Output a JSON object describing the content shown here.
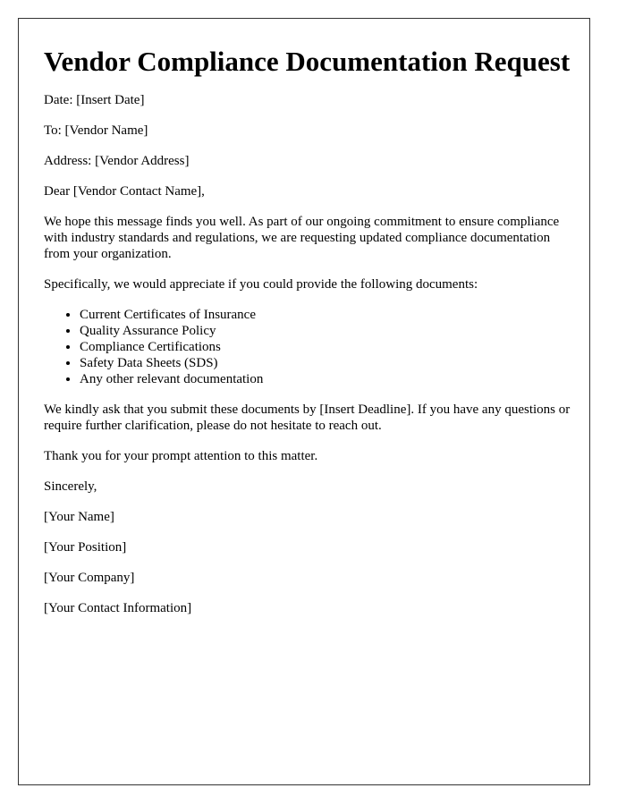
{
  "document": {
    "title": "Vendor Compliance Documentation Request",
    "date_line": "Date: [Insert Date]",
    "to_line": "To: [Vendor Name]",
    "address_line": "Address: [Vendor Address]",
    "salutation": "Dear [Vendor Contact Name],",
    "intro_paragraph": "We hope this message finds you well. As part of our ongoing commitment to ensure compliance with industry standards and regulations, we are requesting updated compliance documentation from your organization.",
    "list_intro": "Specifically, we would appreciate if you could provide the following documents:",
    "documents": [
      "Current Certificates of Insurance",
      "Quality Assurance Policy",
      "Compliance Certifications",
      "Safety Data Sheets (SDS)",
      "Any other relevant documentation"
    ],
    "deadline_paragraph": "We kindly ask that you submit these documents by [Insert Deadline]. If you have any questions or require further clarification, please do not hesitate to reach out.",
    "thanks_line": "Thank you for your prompt attention to this matter.",
    "closing": "Sincerely,",
    "signature": {
      "name": "[Your Name]",
      "position": "[Your Position]",
      "company": "[Your Company]",
      "contact": "[Your Contact Information]"
    }
  }
}
